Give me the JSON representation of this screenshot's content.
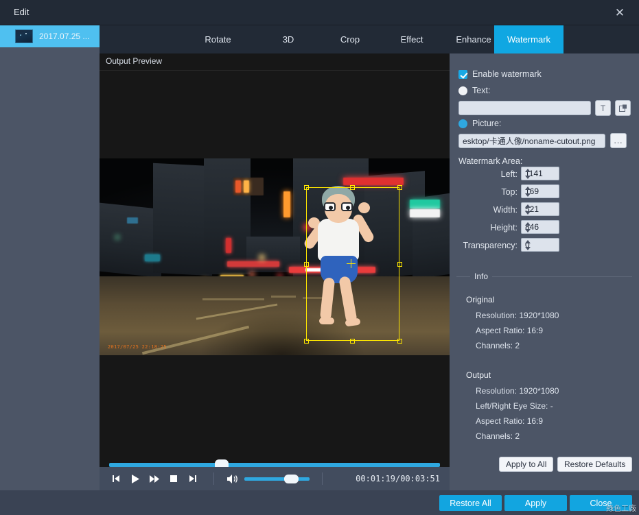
{
  "window": {
    "title": "Edit",
    "close_icon": "close-icon"
  },
  "filelist": {
    "items": [
      {
        "label": "2017.07.25 ...",
        "selected": true
      }
    ]
  },
  "tabs": [
    {
      "label": "Rotate",
      "active": false
    },
    {
      "label": "3D",
      "active": false
    },
    {
      "label": "Crop",
      "active": false
    },
    {
      "label": "Effect",
      "active": false
    },
    {
      "label": "Enhance",
      "active": false
    },
    {
      "label": "Watermark",
      "active": true
    }
  ],
  "preview": {
    "header_label": "Output Preview",
    "dashcam_overlay": "2017/07/25 22:18:25",
    "seek_percent": 34,
    "controls": {
      "prev_icon": "skip-previous-icon",
      "play_icon": "play-icon",
      "forward_icon": "fast-forward-icon",
      "stop_icon": "stop-icon",
      "next_icon": "skip-next-icon",
      "volume_icon": "volume-icon",
      "volume_percent": 83,
      "timecode": "00:01:19/00:03:51"
    }
  },
  "settings": {
    "enable_watermark": {
      "label": "Enable watermark",
      "checked": true
    },
    "text_option": {
      "label": "Text:",
      "selected": false
    },
    "text_value": "",
    "text_placeholder": "",
    "font_button_icon": "font-T-icon",
    "color_button_icon": "color-layers-icon",
    "picture_option": {
      "label": "Picture:",
      "selected": true
    },
    "picture_path": "esktop/卡通人像/noname-cutout.png",
    "browse_label": "...",
    "area_title": "Watermark Area:",
    "fields": [
      {
        "label": "Left:",
        "value": "1141"
      },
      {
        "label": "Top:",
        "value": "169"
      },
      {
        "label": "Width:",
        "value": "521"
      },
      {
        "label": "Height:",
        "value": "846"
      },
      {
        "label": "Transparency:",
        "value": "0"
      }
    ],
    "info": {
      "title": "Info",
      "original_title": "Original",
      "original_lines": [
        "Resolution: 1920*1080",
        "Aspect Ratio: 16:9",
        "Channels: 2"
      ],
      "output_title": "Output",
      "output_lines": [
        "Resolution: 1920*1080",
        "Left/Right Eye Size: -",
        "Aspect Ratio: 16:9",
        "Channels: 2"
      ]
    },
    "apply_to_all_label": "Apply to All",
    "restore_defaults_label": "Restore Defaults"
  },
  "bottom": {
    "restore_all_label": "Restore All",
    "apply_label": "Apply",
    "close_label": "Close"
  },
  "overlay_watermark": "綠色工廠",
  "colors": {
    "accent": "#10a7e2",
    "panel": "#4c5566",
    "titlebar": "#222a36",
    "preview_bg": "#171717",
    "selection": "#ffe800"
  }
}
